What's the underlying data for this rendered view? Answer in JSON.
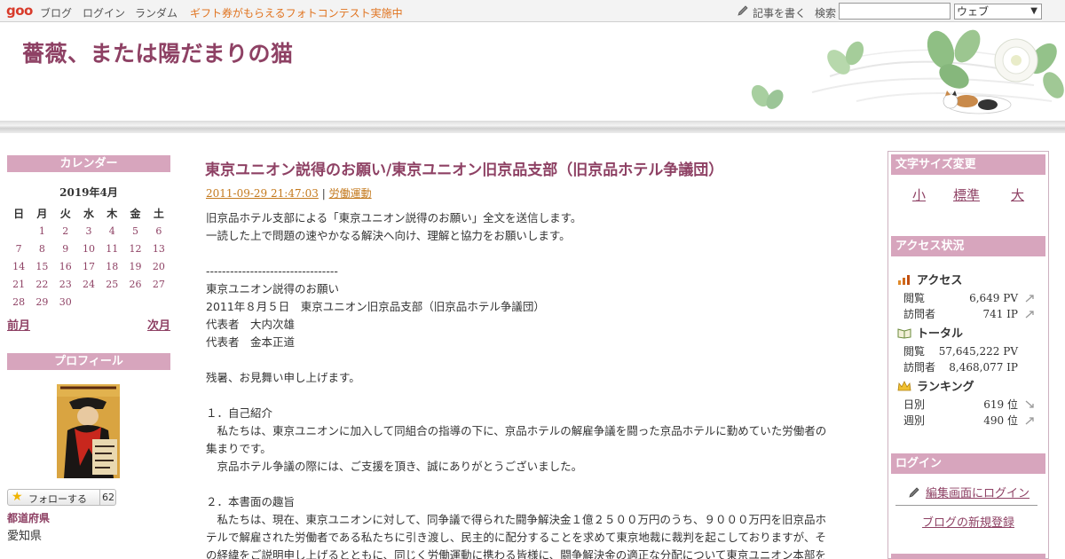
{
  "topbar": {
    "logo": "goo",
    "nav": [
      "ブログ",
      "ログイン",
      "ランダム"
    ],
    "promo": "ギフト券がもらえるフォトコンテスト実施中",
    "write": "記事を書く",
    "search_label": "検索",
    "search_value": "",
    "search_scope": "ウェブ"
  },
  "header": {
    "blog_title": "薔薇、または陽だまりの猫"
  },
  "calendar": {
    "heading": "カレンダー",
    "month": "2019年4月",
    "weekdays": [
      "日",
      "月",
      "火",
      "水",
      "木",
      "金",
      "土"
    ],
    "weeks": [
      [
        "",
        "1",
        "2",
        "3",
        "4",
        "5",
        "6"
      ],
      [
        "7",
        "8",
        "9",
        "10",
        "11",
        "12",
        "13"
      ],
      [
        "14",
        "15",
        "16",
        "17",
        "18",
        "19",
        "20"
      ],
      [
        "21",
        "22",
        "23",
        "24",
        "25",
        "26",
        "27"
      ],
      [
        "28",
        "29",
        "30",
        "",
        "",
        "",
        ""
      ]
    ],
    "prev": "前月",
    "next": "次月"
  },
  "profile": {
    "heading": "プロフィール",
    "follow_label": "フォローする",
    "follow_count": "62",
    "pref_label": "都道府県",
    "pref_value": "愛知県"
  },
  "post": {
    "title": "東京ユニオン説得のお願い/東京ユニオン旧京品支部（旧京品ホテル争議団）",
    "date": "2011-09-29 21:47:03",
    "separator": "|",
    "category": "労働運動",
    "lines": [
      "旧京品ホテル支部による「東京ユニオン説得のお願い」全文を送信します。",
      "一読した上で問題の速やかなる解決へ向け、理解と協力をお願いします。",
      "",
      "---------------------------------",
      "東京ユニオン説得のお願い",
      "2011年８月５日　東京ユニオン旧京品支部（旧京品ホテル争議団）",
      "代表者　大内次雄",
      "代表者　金本正道",
      "",
      "残暑、お見舞い申し上げます。",
      "",
      "１．自己紹介",
      "　私たちは、東京ユニオンに加入して同組合の指導の下に、京品ホテルの解雇争議を闘った京品ホテルに勤めていた労働者の",
      "集まりです。",
      "　京品ホテル争議の際には、ご支援を頂き、誠にありがとうございました。",
      "",
      "２．本書面の趣旨",
      "　私たちは、現在、東京ユニオンに対して、同争議で得られた闘争解決金１億２５００万円のうち、９０００万円を旧京品ホ",
      "テルで解雇された労働者である私たちに引き渡し、民主的に配分することを求めて東京地裁に裁判を起こしておりますが、そ",
      "の経緯をご説明申し上げるとともに、同じく労働運動に携わる皆様に、闘争解決金の適正な分配について東京ユニオン本部を"
    ]
  },
  "font_size": {
    "heading": "文字サイズ変更",
    "small": "小",
    "normal": "標準",
    "large": "大"
  },
  "access": {
    "heading": "アクセス状況",
    "groups": [
      {
        "title": "アクセス",
        "icon": "chart-icon",
        "rows": [
          {
            "label": "閲覧",
            "value": "6,649 PV"
          },
          {
            "label": "訪問者",
            "value": "741 IP"
          }
        ]
      },
      {
        "title": "トータル",
        "icon": "book-icon",
        "rows": [
          {
            "label": "閲覧",
            "value": "57,645,222 PV"
          },
          {
            "label": "訪問者",
            "value": "8,468,077 IP"
          }
        ]
      },
      {
        "title": "ランキング",
        "icon": "crown-icon",
        "rows": [
          {
            "label": "日別",
            "value": "619 位"
          },
          {
            "label": "週別",
            "value": "490 位"
          }
        ]
      }
    ]
  },
  "login": {
    "heading": "ログイン",
    "edit_link": "編集画面にログイン",
    "signup_link": "ブログの新規登録"
  },
  "colors": {
    "accent": "#8e4164",
    "heading_bg": "#d7a5bd",
    "promo": "#e0731f",
    "meta_link": "#c47a1e"
  }
}
